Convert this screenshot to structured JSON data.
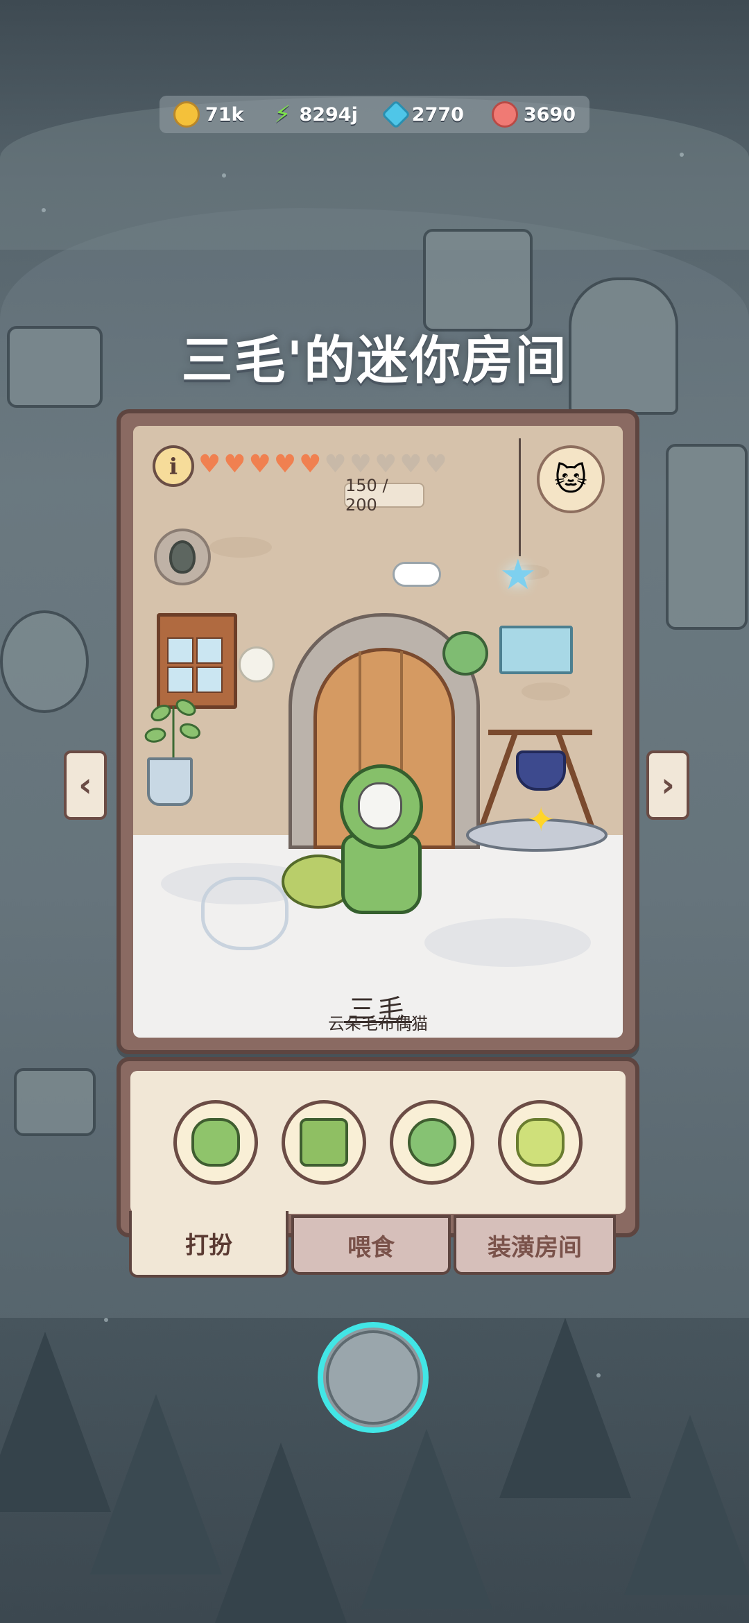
{
  "currency": {
    "coins": "71k",
    "energy": "8294j",
    "gems": "2770",
    "paws": "3690",
    "icons": [
      "coin-icon",
      "lightning-icon",
      "gem-icon",
      "paw-icon"
    ]
  },
  "room": {
    "title": "三毛'的迷你房间",
    "info_label": "i",
    "hearts_filled": 5,
    "hearts_total": 10,
    "heart_count": "150 / 200",
    "pet_name": "三毛",
    "pet_description": "云朵毛布偶猫"
  },
  "tabs": [
    {
      "label": "打扮",
      "active": true
    },
    {
      "label": "喂食",
      "active": false
    },
    {
      "label": "装潢房间",
      "active": false
    }
  ],
  "items": [
    "frog-hat-item",
    "frog-outfit-item",
    "leaf-item",
    "bow-frog-item"
  ],
  "colors": {
    "accent_cyan": "#42e6e6",
    "heart": "#f08050",
    "panel_brown": "#8a6a62"
  }
}
